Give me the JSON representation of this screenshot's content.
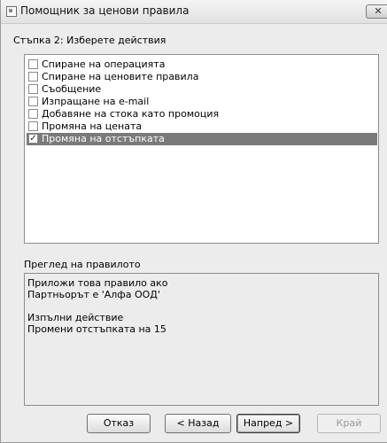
{
  "window": {
    "title": "Помощник за ценови правила",
    "close_label": "✕"
  },
  "step": {
    "label": "Стъпка 2: Изберете действия"
  },
  "actions": [
    {
      "label": "Спиране на операцията",
      "checked": false,
      "selected": false
    },
    {
      "label": "Спиране на ценовите правила",
      "checked": false,
      "selected": false
    },
    {
      "label": "Съобщение",
      "checked": false,
      "selected": false
    },
    {
      "label": "Изпращане на e-mail",
      "checked": false,
      "selected": false
    },
    {
      "label": "Добавяне на стока като промоция",
      "checked": false,
      "selected": false
    },
    {
      "label": "Промяна на цената",
      "checked": false,
      "selected": false
    },
    {
      "label": "Промяна на отстъпката",
      "checked": true,
      "selected": true
    }
  ],
  "preview": {
    "label": "Преглед на правилото",
    "lines": [
      "Приложи това правило ако",
      "Партньорът  е 'Алфа ООД'",
      "",
      "Изпълни действие",
      "Промени отстъпката на 15"
    ]
  },
  "buttons": {
    "cancel": "Отказ",
    "back": "< Назад",
    "next": "Напред >",
    "finish": "Край"
  }
}
